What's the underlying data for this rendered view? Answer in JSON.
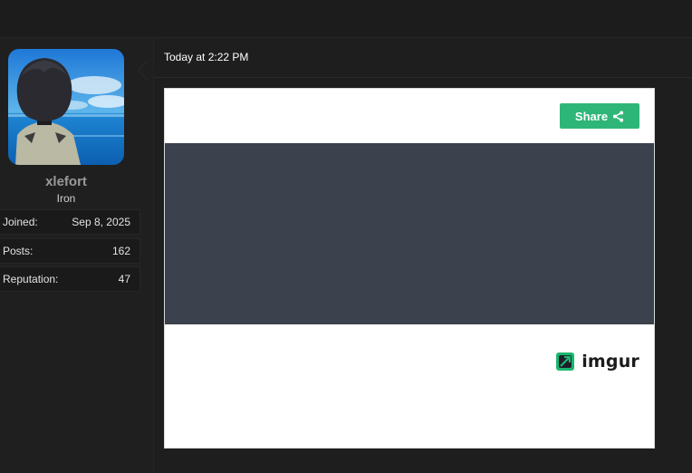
{
  "message": {
    "timestamp": "Today at 2:22 PM"
  },
  "user": {
    "username": "xlefort",
    "rank": "Iron",
    "stats": [
      {
        "label": "Joined:",
        "value": "Sep 8, 2025"
      },
      {
        "label": "Posts:",
        "value": "162"
      },
      {
        "label": "Reputation:",
        "value": "47"
      }
    ]
  },
  "embed": {
    "share_label": "Share",
    "brand": "imgur",
    "share_color": "#2eb678",
    "media_color": "#3b424d"
  }
}
